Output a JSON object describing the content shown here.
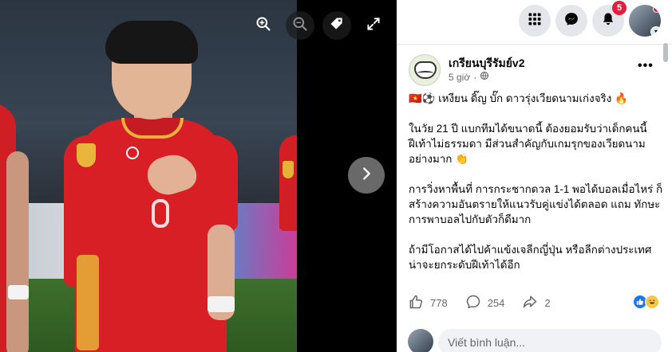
{
  "viewer": {
    "zoom_in_icon": "zoom-in-icon",
    "zoom_out_icon": "zoom-out-icon",
    "tag_icon": "tag-icon",
    "fullscreen_icon": "expand-icon",
    "next_icon": "chevron-right-icon"
  },
  "topbar": {
    "menu_icon": "grid-menu-icon",
    "messenger_icon": "messenger-icon",
    "notifications_icon": "bell-icon",
    "notification_count": "5"
  },
  "post": {
    "author": "เกรียนบุรีรัมย์v2",
    "time": "5 giờ",
    "audience_icon": "globe-icon",
    "more_label": "•••",
    "paragraphs": [
      "🇻🇳⚽️ เหงียน ดิ๊ญ บั๊ก ดาวรุ่งเวียดนามเก่งจริง 🔥",
      "ในวัย 21 ปี แบกทีมได้ขนาดนี้ ต้องยอมรับว่าเด็กคนนี้ ฝีเท้าไม่ธรรมดา มีส่วนสำคัญกับเกมรุกของเวียดนาม อย่างมาก 👏",
      "การวิ่งหาพื้นที่ การกระชากดวล 1-1 พอได้บอลเมื่อไหร่ ก็สร้างความอันตรายให้แนวรับคู่แข่งได้ตลอด แถม ทักษะการพาบอลไปกับตัวก็ดีมาก",
      "ถ้ามีโอกาสได้ไปค้าแข้งเจลีกญี่ปุ่น หรือลีกต่างประเทศ น่าจะยกระดับฝีเท้าได้อีก"
    ],
    "likes": "778",
    "comments": "254",
    "shares": "2",
    "comment_placeholder": "Viết bình luận..."
  },
  "colors": {
    "accent": "#1877f2",
    "badge": "#e41e3f",
    "muted": "#65676b"
  }
}
